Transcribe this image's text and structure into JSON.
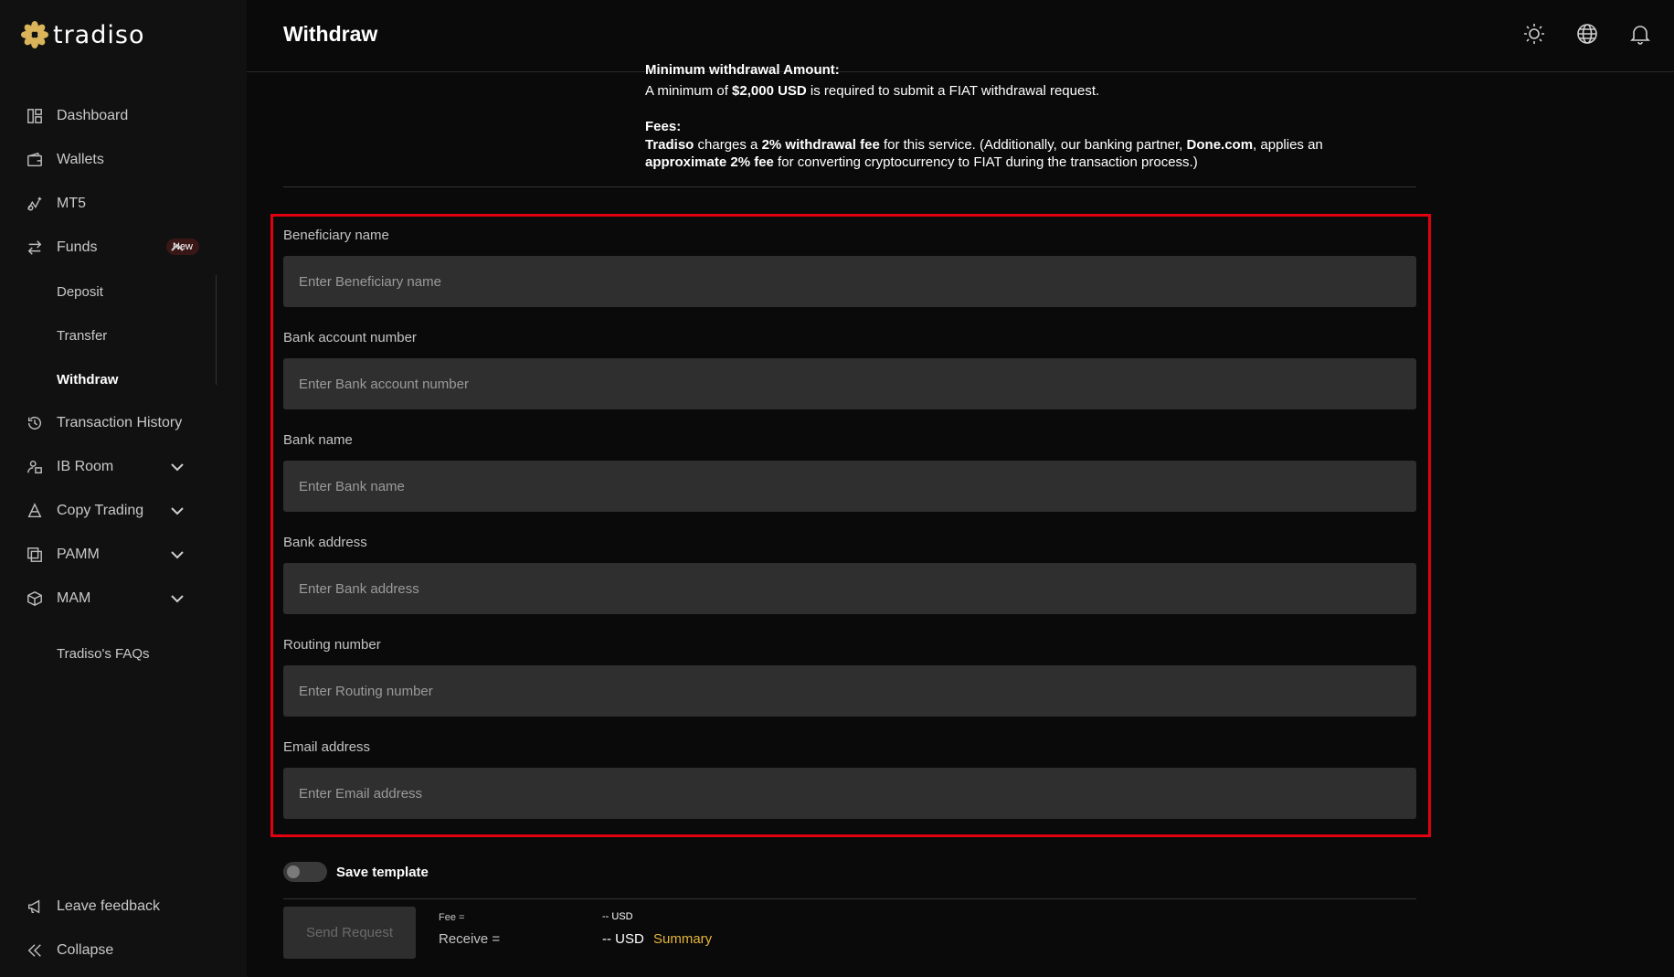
{
  "brand": {
    "name": "tradiso",
    "logo_color": "#d9b45a"
  },
  "header": {
    "title": "Withdraw",
    "icons": [
      "sun-icon",
      "globe-icon",
      "bell-icon"
    ]
  },
  "sidebar": {
    "items": [
      {
        "label": "Dashboard",
        "icon": "dashboard-icon"
      },
      {
        "label": "Wallets",
        "icon": "wallet-icon"
      },
      {
        "label": "MT5",
        "icon": "mt5-icon"
      },
      {
        "label": "Funds",
        "icon": "transfer-arrows-icon",
        "badge": "New",
        "expanded": true,
        "children": [
          {
            "label": "Deposit"
          },
          {
            "label": "Transfer"
          },
          {
            "label": "Withdraw",
            "active": true
          }
        ]
      },
      {
        "label": "Transaction History",
        "icon": "history-icon"
      },
      {
        "label": "IB Room",
        "icon": "ib-room-icon"
      },
      {
        "label": "Copy Trading",
        "icon": "copy-trading-icon"
      },
      {
        "label": "PAMM",
        "icon": "pamm-icon"
      },
      {
        "label": "MAM",
        "icon": "mam-icon"
      }
    ],
    "faq": "Tradiso's FAQs",
    "bottom": [
      {
        "label": "Leave feedback",
        "icon": "megaphone-icon"
      },
      {
        "label": "Collapse",
        "icon": "double-chevron-left-icon"
      }
    ]
  },
  "info": {
    "min_heading": "Minimum withdrawal Amount:",
    "min_text_pre": "A minimum of ",
    "min_amount": "$2,000 USD",
    "min_text_post": " is required to submit a FIAT withdrawal request.",
    "fees_heading": "Fees:",
    "fees_brand": "Tradiso",
    "fees_t1": " charges a ",
    "fees_b1": "2% withdrawal fee",
    "fees_t2": " for this service. (Additionally, our banking partner, ",
    "fees_b2": "Done.com",
    "fees_t3": ", applies an ",
    "fees_b3": "approximate 2% fee",
    "fees_t4": " for converting cryptocurrency to FIAT during the transaction process.)"
  },
  "form": {
    "fields": [
      {
        "label": "Beneficiary name",
        "placeholder": "Enter Beneficiary name",
        "value": ""
      },
      {
        "label": "Bank account number",
        "placeholder": "Enter Bank account number",
        "value": ""
      },
      {
        "label": "Bank name",
        "placeholder": "Enter Bank name",
        "value": ""
      },
      {
        "label": "Bank address",
        "placeholder": "Enter Bank address",
        "value": ""
      },
      {
        "label": "Routing number",
        "placeholder": "Enter Routing number",
        "value": ""
      },
      {
        "label": "Email address",
        "placeholder": "Enter Email address",
        "value": ""
      }
    ],
    "highlight_color": "#e0000f"
  },
  "save_template": {
    "label": "Save template",
    "enabled": false
  },
  "footer": {
    "send_label": "Send Request",
    "fee_label": "Fee =",
    "fee_value": "-- USD",
    "receive_label": "Receive =",
    "receive_value": "-- USD",
    "summary_label": "Summary",
    "summary_color": "#e5b43c"
  }
}
